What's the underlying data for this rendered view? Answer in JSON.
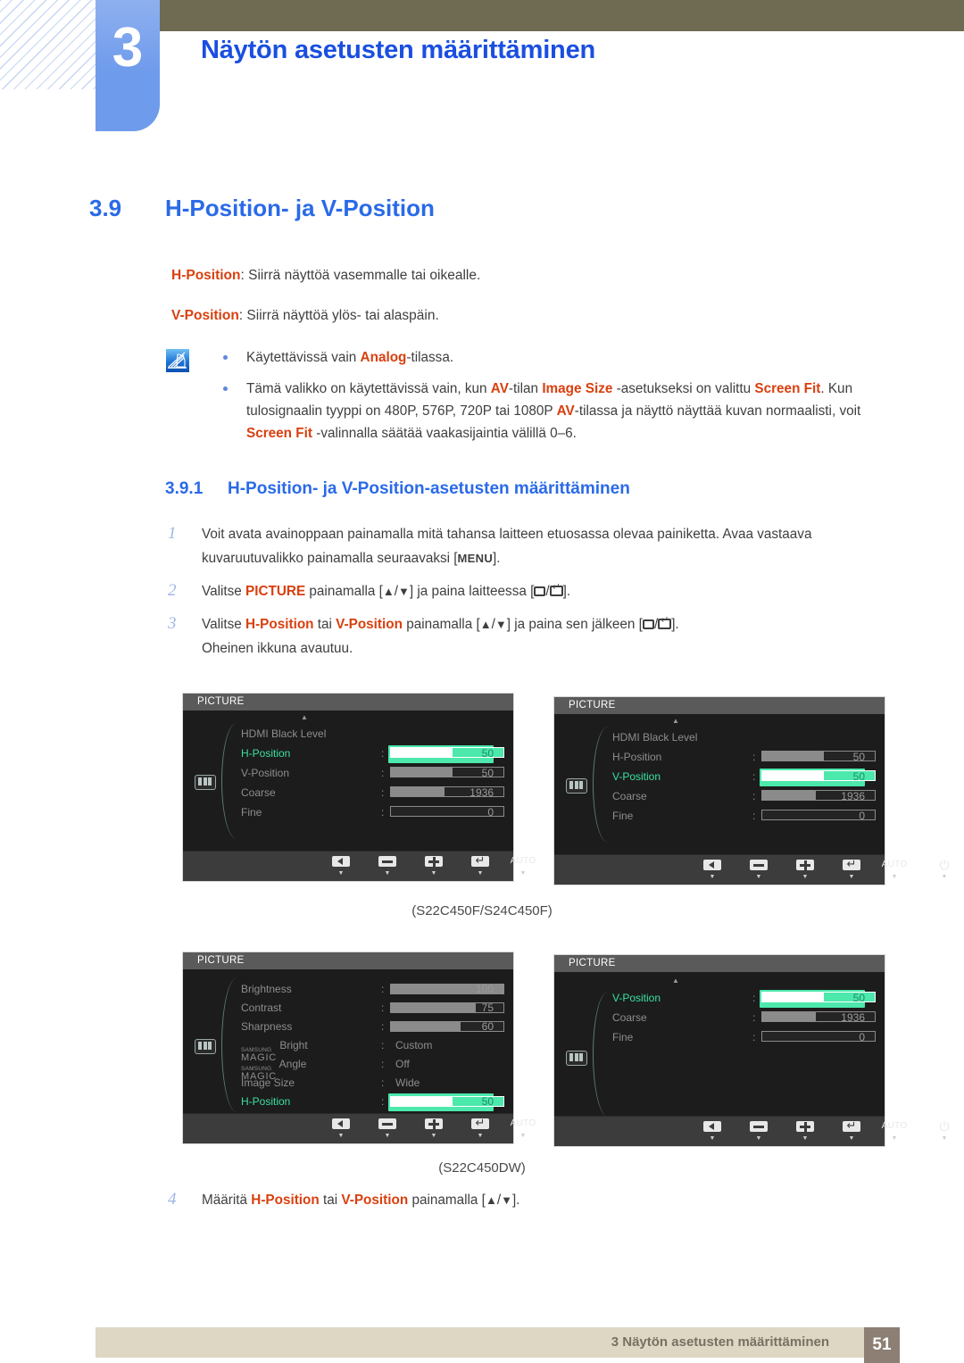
{
  "header": {
    "chapter_number": "3",
    "chapter_title": "Näytön asetusten määrittäminen"
  },
  "section": {
    "number": "3.9",
    "title": "H-Position- ja V-Position"
  },
  "intro": {
    "line1_term": "H-Position",
    "line1_rest": ": Siirrä näyttöä vasemmalle tai oikealle.",
    "line2_term": "V-Position",
    "line2_rest": ": Siirrä näyttöä ylös- tai alaspäin."
  },
  "note": {
    "icon": "note-pencil-icon",
    "items": [
      {
        "parts": [
          {
            "t": "Käytettävissä vain ",
            "hl": false
          },
          {
            "t": "Analog",
            "hl": true
          },
          {
            "t": "-tilassa.",
            "hl": false
          }
        ]
      },
      {
        "parts": [
          {
            "t": "Tämä valikko on käytettävissä vain, kun ",
            "hl": false
          },
          {
            "t": "AV",
            "hl": true
          },
          {
            "t": "-tilan ",
            "hl": false
          },
          {
            "t": "Image Size",
            "hl": true
          },
          {
            "t": " -asetukseksi on valittu ",
            "hl": false
          },
          {
            "t": "Screen Fit",
            "hl": true
          },
          {
            "t": ". Kun tulosignaalin tyyppi on 480P, 576P, 720P tai 1080P ",
            "hl": false
          },
          {
            "t": "AV",
            "hl": true
          },
          {
            "t": "-tilassa ja näyttö näyttää kuvan normaalisti, voit ",
            "hl": false
          },
          {
            "t": "Screen Fit",
            "hl": true
          },
          {
            "t": " -valinnalla säätää vaakasijaintia välillä 0–6.",
            "hl": false
          }
        ]
      }
    ]
  },
  "subsection": {
    "number": "3.9.1",
    "title": "H-Position- ja V-Position-asetusten määrittäminen"
  },
  "steps": [
    {
      "num": "1",
      "parts": [
        {
          "t": "Voit avata avainoppaan painamalla mitä tahansa laitteen etuosassa olevaa painiketta. Avaa vastaava kuvaruutuvalikko painamalla seuraavaksi [",
          "k": "text"
        },
        {
          "t": "MENU",
          "k": "kbd"
        },
        {
          "t": "].",
          "k": "text"
        }
      ]
    },
    {
      "num": "2",
      "parts": [
        {
          "t": "Valitse ",
          "k": "text"
        },
        {
          "t": "PICTURE",
          "k": "hl"
        },
        {
          "t": " painamalla [",
          "k": "text"
        },
        {
          "t": "▲",
          "k": "tri"
        },
        {
          "t": "/",
          "k": "text"
        },
        {
          "t": "▼",
          "k": "tri"
        },
        {
          "t": "] ja paina laitteessa [",
          "k": "text"
        },
        {
          "t": "",
          "k": "box"
        },
        {
          "t": "/",
          "k": "text"
        },
        {
          "t": "",
          "k": "ent"
        },
        {
          "t": "].",
          "k": "text"
        }
      ]
    },
    {
      "num": "3",
      "parts": [
        {
          "t": "Valitse ",
          "k": "text"
        },
        {
          "t": "H-Position",
          "k": "hl"
        },
        {
          "t": " tai ",
          "k": "text"
        },
        {
          "t": "V-Position",
          "k": "hl"
        },
        {
          "t": " painamalla [",
          "k": "text"
        },
        {
          "t": "▲",
          "k": "tri"
        },
        {
          "t": "/",
          "k": "text"
        },
        {
          "t": "▼",
          "k": "tri"
        },
        {
          "t": "] ja paina sen jälkeen [",
          "k": "text"
        },
        {
          "t": "",
          "k": "box"
        },
        {
          "t": "/",
          "k": "text"
        },
        {
          "t": "",
          "k": "ent"
        },
        {
          "t": "].",
          "k": "text"
        }
      ],
      "extra": "Oheinen ikkuna avautuu."
    }
  ],
  "step4": {
    "num": "4",
    "parts": [
      {
        "t": "Määritä ",
        "k": "text"
      },
      {
        "t": "H-Position",
        "k": "hl"
      },
      {
        "t": " tai ",
        "k": "text"
      },
      {
        "t": "V-Position",
        "k": "hl"
      },
      {
        "t": " painamalla [",
        "k": "text"
      },
      {
        "t": "▲",
        "k": "tri"
      },
      {
        "t": "/",
        "k": "text"
      },
      {
        "t": "▼",
        "k": "tri"
      },
      {
        "t": "].",
        "k": "text"
      }
    ]
  },
  "osd": {
    "title": "PICTURE",
    "footer_buttons": [
      {
        "icon": "left-arrow-icon",
        "label": ""
      },
      {
        "icon": "minus-icon",
        "label": ""
      },
      {
        "icon": "plus-icon",
        "label": ""
      },
      {
        "icon": "enter-return-icon",
        "label": ""
      },
      {
        "icon": "auto-label",
        "label": "AUTO"
      },
      {
        "icon": "power-icon",
        "label": ""
      }
    ],
    "panel1": {
      "rows": [
        {
          "label": "HDMI Black Level",
          "type": "none",
          "selected": false
        },
        {
          "label": "H-Position",
          "type": "bar",
          "value": "50",
          "fill": 55,
          "selected": true
        },
        {
          "label": "V-Position",
          "type": "bar",
          "value": "50",
          "fill": 55,
          "selected": false
        },
        {
          "label": "Coarse",
          "type": "bar",
          "value": "1936",
          "fill": 48,
          "selected": false
        },
        {
          "label": "Fine",
          "type": "bar",
          "value": "0",
          "fill": 0,
          "selected": false
        }
      ]
    },
    "panel2": {
      "rows": [
        {
          "label": "HDMI Black Level",
          "type": "none",
          "selected": false
        },
        {
          "label": "H-Position",
          "type": "bar",
          "value": "50",
          "fill": 55,
          "selected": false
        },
        {
          "label": "V-Position",
          "type": "bar",
          "value": "50",
          "fill": 55,
          "selected": true
        },
        {
          "label": "Coarse",
          "type": "bar",
          "value": "1936",
          "fill": 48,
          "selected": false
        },
        {
          "label": "Fine",
          "type": "bar",
          "value": "0",
          "fill": 0,
          "selected": false
        }
      ]
    },
    "panel3": {
      "rows": [
        {
          "label": "Brightness",
          "type": "bar",
          "value": "100",
          "fill": 100,
          "selected": false
        },
        {
          "label": "Contrast",
          "type": "bar",
          "value": "75",
          "fill": 75,
          "selected": false
        },
        {
          "label": "Sharpness",
          "type": "bar",
          "value": "60",
          "fill": 62,
          "selected": false
        },
        {
          "label": "MAGIC Bright",
          "magic_top": "SAMSUNG",
          "magic_main": "MAGIC",
          "magic_suffix": "Bright",
          "type": "text",
          "value": "Custom",
          "selected": false
        },
        {
          "label": "MAGIC Angle",
          "magic_top": "SAMSUNG",
          "magic_main": "MAGIC",
          "magic_suffix": "Angle",
          "type": "text",
          "value": "Off",
          "selected": false
        },
        {
          "label": "Image Size",
          "type": "text",
          "value": "Wide",
          "selected": false
        },
        {
          "label": "H-Position",
          "type": "bar",
          "value": "50",
          "fill": 55,
          "selected": true
        }
      ]
    },
    "panel4": {
      "rows": [
        {
          "label": "V-Position",
          "type": "bar",
          "value": "50",
          "fill": 55,
          "selected": true
        },
        {
          "label": "Coarse",
          "type": "bar",
          "value": "1936",
          "fill": 48,
          "selected": false
        },
        {
          "label": "Fine",
          "type": "bar",
          "value": "0",
          "fill": 0,
          "selected": false
        }
      ]
    }
  },
  "captions": {
    "top": "(S22C450F/S24C450F)",
    "bottom": "(S22C450DW)"
  },
  "footer": {
    "text": "3 Näytön asetusten määrittäminen",
    "page": "51"
  },
  "colors": {
    "accent_blue": "#2a6ae8",
    "highlight_orange": "#d9400f",
    "header_olive": "#6e6b52",
    "chapter_blue": "#6f9bec",
    "osd_green": "#4ce8ac",
    "footer_band": "#ddd7c4",
    "footer_page": "#8d7f74"
  }
}
